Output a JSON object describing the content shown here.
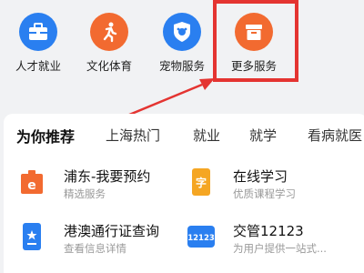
{
  "services": [
    {
      "label": "人才就业",
      "icon": "briefcase-icon",
      "color": "#2a7ff0"
    },
    {
      "label": "文化体育",
      "icon": "running-person-icon",
      "color": "#f26a30"
    },
    {
      "label": "宠物服务",
      "icon": "pet-shield-icon",
      "color": "#2a7ff0"
    },
    {
      "label": "更多服务",
      "icon": "box-icon",
      "color": "#f26a30"
    }
  ],
  "recommend": {
    "tabs": [
      "为你推荐",
      "上海热门",
      "就业",
      "就学",
      "看病就医"
    ],
    "items": [
      {
        "title": "浦东-我要预约",
        "subtitle": "精选服务",
        "icon": "calendar-e-icon",
        "color": "#f26a30"
      },
      {
        "title": "在线学习",
        "subtitle": "优质课程学习",
        "icon": "study-phone-icon",
        "color": "#f5a623"
      },
      {
        "title": "港澳通行证查询",
        "subtitle": "查看信息详情",
        "icon": "pass-card-icon",
        "color": "#2a7ff0"
      },
      {
        "title": "交管12123",
        "subtitle": "为用户提供一站式...",
        "icon": "traffic-12123-icon",
        "icon_text": "12123",
        "color": "#2a7ff0"
      }
    ]
  },
  "highlight_color": "#e43431"
}
